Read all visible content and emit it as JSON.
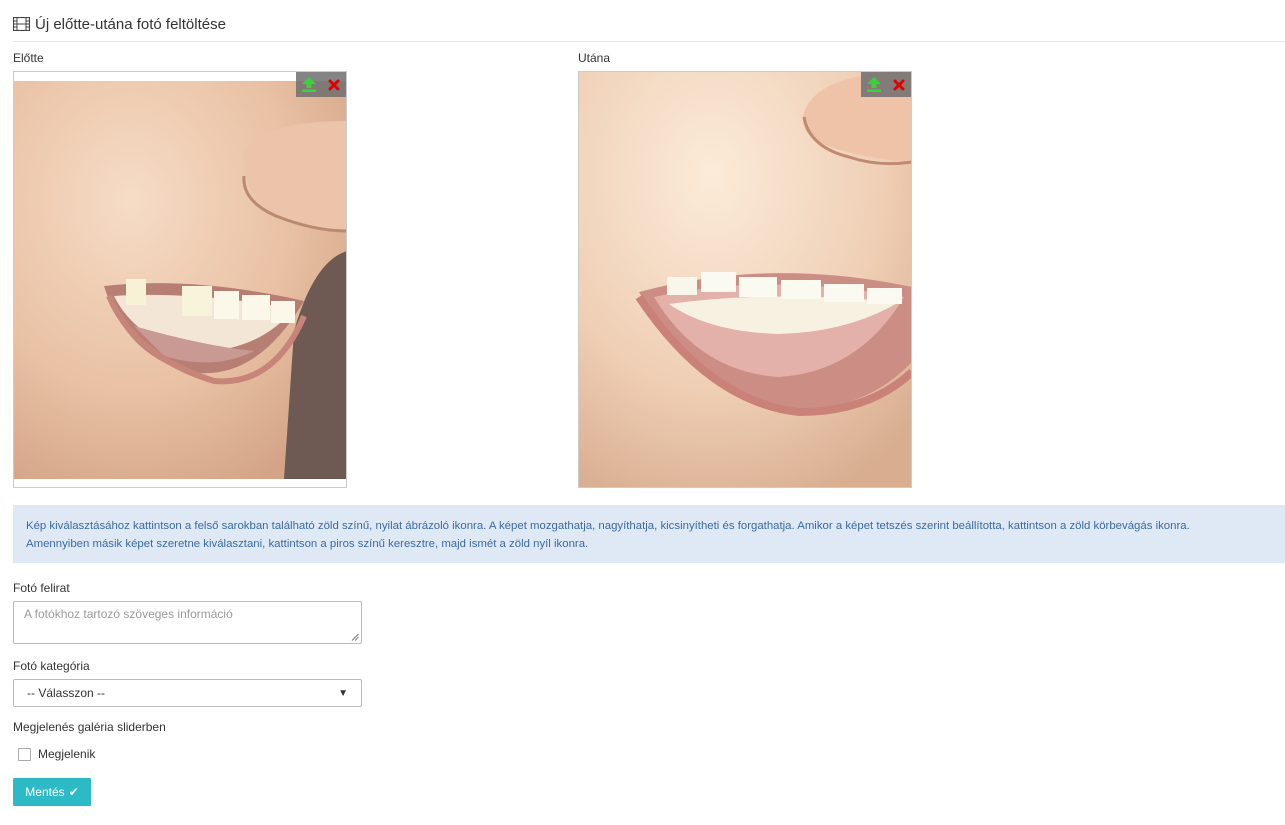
{
  "page": {
    "title": "Új előtte-utána fotó feltöltése",
    "title_icon": "film-icon"
  },
  "photos": {
    "before": {
      "label": "Előtte",
      "upload_icon": "upload-arrow-icon",
      "remove_icon": "remove-x-icon"
    },
    "after": {
      "label": "Utána",
      "upload_icon": "upload-arrow-icon",
      "remove_icon": "remove-x-icon"
    }
  },
  "info": {
    "line1": "Kép kiválasztásához kattintson a felső sarokban található zöld színű, nyilat ábrázoló ikonra. A képet mozgathatja, nagyíthatja, kicsinyítheti és forgathatja. Amikor a képet tetszés szerint beállította, kattintson a zöld körbevágás ikonra.",
    "line2": "Amennyiben másik képet szeretne kiválasztani, kattintson a piros színű keresztre, majd ismét a zöld nyíl ikonra."
  },
  "form": {
    "caption_label": "Fotó felirat",
    "caption_placeholder": "A fotókhoz tartozó szöveges információ",
    "category_label": "Fotó kategória",
    "category_selected": "-- Válasszon --",
    "slider_label": "Megjelenés galéria sliderben",
    "slider_checkbox_label": "Megjelenik",
    "slider_checked": false,
    "save_label": "Mentés"
  },
  "colors": {
    "accent": "#2cbac6",
    "info_bg": "#dfe9f5",
    "info_text": "#3a6aa3",
    "upload_green": "#3bd13b",
    "remove_red": "#e00000"
  }
}
